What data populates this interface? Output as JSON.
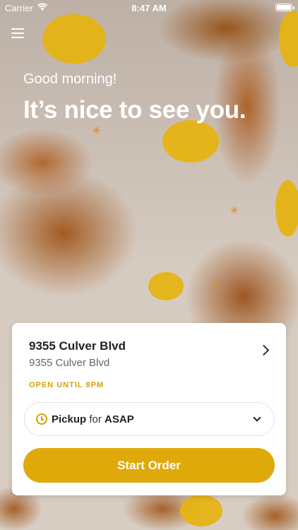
{
  "status_bar": {
    "carrier": "Carrier",
    "time": "8:47 AM"
  },
  "hero": {
    "greeting": "Good morning!",
    "headline": "It’s nice to see you."
  },
  "location": {
    "name": "9355 Culver Blvd",
    "address": "9355 Culver Blvd",
    "hours_status": "OPEN UNTIL 8PM"
  },
  "order_type": {
    "mode": "Pickup",
    "connector": "for",
    "time": "ASAP"
  },
  "actions": {
    "start_order_label": "Start Order"
  },
  "colors": {
    "accent": "#e0a90a",
    "status_text": "#d7a006"
  },
  "icons": [
    "wifi-icon",
    "battery-icon",
    "menu-icon",
    "chevron-right-icon",
    "clock-icon",
    "chevron-down-icon"
  ]
}
